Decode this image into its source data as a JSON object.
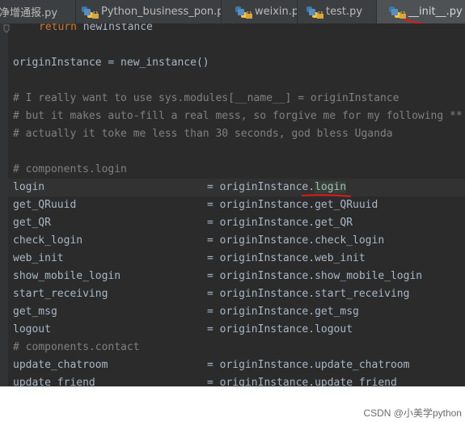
{
  "tabs": [
    {
      "label": "盛净增通报.py",
      "active": false
    },
    {
      "label": "Python_business_pon.py",
      "active": false
    },
    {
      "label": "weixin.py",
      "active": false
    },
    {
      "label": "test.py",
      "active": false
    },
    {
      "label": "__init__.py",
      "active": true
    }
  ],
  "code": {
    "return_kw": "return",
    "return_rest": " newInstance",
    "assign_line": "originInstance = new_instance()",
    "comment1": "# I really want to use sys.modules[__name__] = originInstance",
    "comment2": "# but it makes auto-fill a real mess, so forgive me for my following **",
    "comment3": "# actually it toke me less than 30 seconds, god bless Uganda",
    "section_login": "# components.login",
    "section_contact": "# components.contact",
    "rows": [
      {
        "name": "login",
        "prefix": "= originInstance.",
        "attr": "login"
      },
      {
        "name": "get_QRuuid",
        "prefix": "= originInstance.",
        "attr": "get_QRuuid"
      },
      {
        "name": "get_QR",
        "prefix": "= originInstance.",
        "attr": "get_QR"
      },
      {
        "name": "check_login",
        "prefix": "= originInstance.",
        "attr": "check_login"
      },
      {
        "name": "web_init",
        "prefix": "= originInstance.",
        "attr": "web_init"
      },
      {
        "name": "show_mobile_login",
        "prefix": "= originInstance.",
        "attr": "show_mobile_login"
      },
      {
        "name": "start_receiving",
        "prefix": "= originInstance.",
        "attr": "start_receiving"
      },
      {
        "name": "get_msg",
        "prefix": "= originInstance.",
        "attr": "get_msg"
      },
      {
        "name": "logout",
        "prefix": "= originInstance.",
        "attr": "logout"
      },
      {
        "name": "update_chatroom",
        "prefix": "= originInstance.",
        "attr": "update_chatroom"
      },
      {
        "name": "update_friend",
        "prefix": "= originInstance.",
        "attr": "update_friend"
      }
    ]
  },
  "watermark": "CSDN @小美学python",
  "colors": {
    "background": "#2b2b2b",
    "keyword": "#cc7832",
    "comment": "#808080",
    "text": "#a9b7c6",
    "annotation": "#e0191c"
  },
  "icons": [
    "python-file-icon",
    "lock-icon",
    "fold-icon"
  ]
}
